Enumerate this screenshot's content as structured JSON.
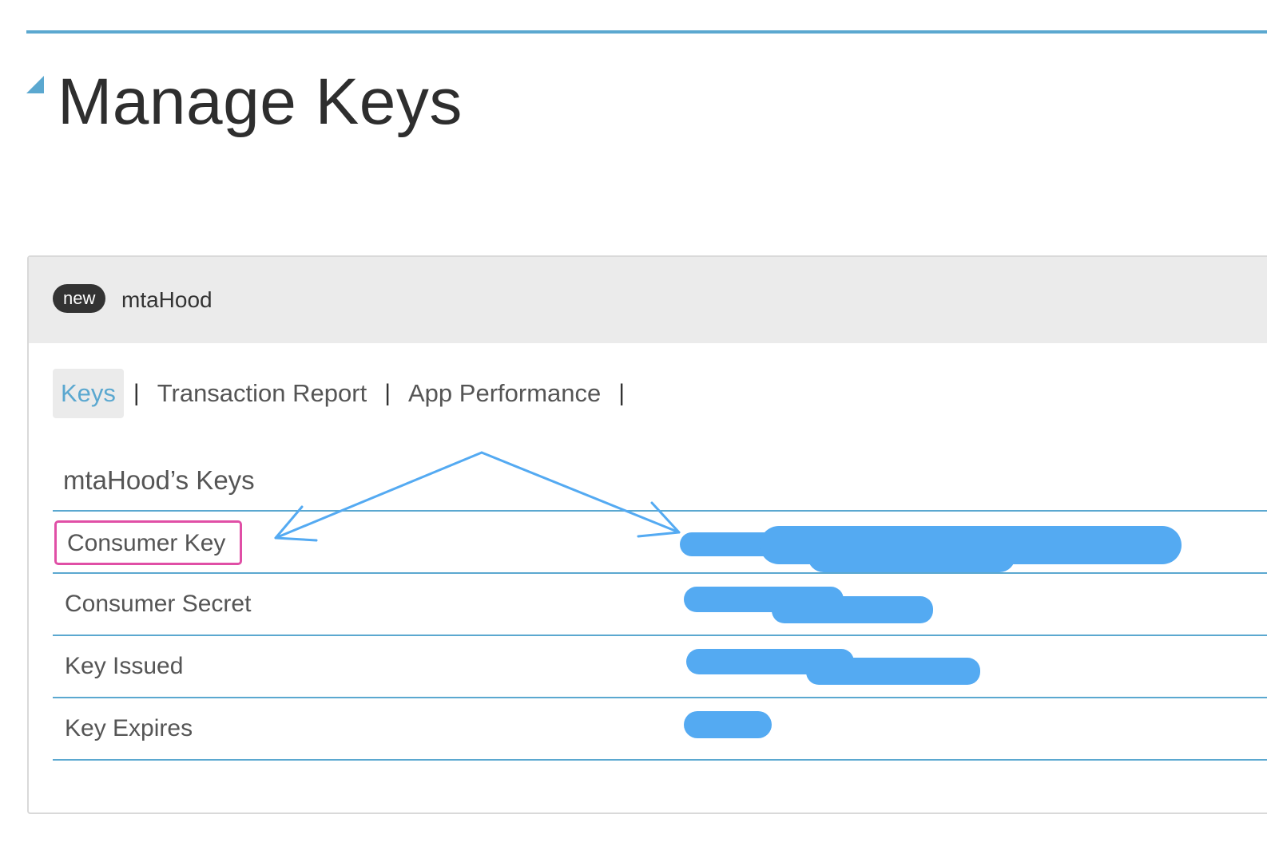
{
  "page": {
    "title": "Manage Keys"
  },
  "app": {
    "badge": "new",
    "name": "mtaHood"
  },
  "tabs": [
    {
      "label": "Keys",
      "active": true
    },
    {
      "label": "Transaction Report",
      "active": false
    },
    {
      "label": "App Performance",
      "active": false
    }
  ],
  "tab_separator": "|",
  "keys_section": {
    "heading": "mtaHood’s Keys",
    "rows": [
      {
        "label": "Consumer Key",
        "value_state": "redacted",
        "highlighted": true
      },
      {
        "label": "Consumer Secret",
        "value_state": "redacted",
        "highlighted": false
      },
      {
        "label": "Key Issued",
        "value_state": "redacted",
        "highlighted": false
      },
      {
        "label": "Key Expires",
        "value_state": "redacted",
        "highlighted": false
      }
    ]
  },
  "annotations": {
    "arrow_color": "#54aaf2",
    "highlight_box_color": "#e04fa6",
    "redaction_color": "#54aaf2"
  },
  "colors": {
    "accent": "#5ba8d0",
    "title_text": "#2e2e2e",
    "badge_bg": "#333333",
    "header_bg": "#ebebeb"
  }
}
